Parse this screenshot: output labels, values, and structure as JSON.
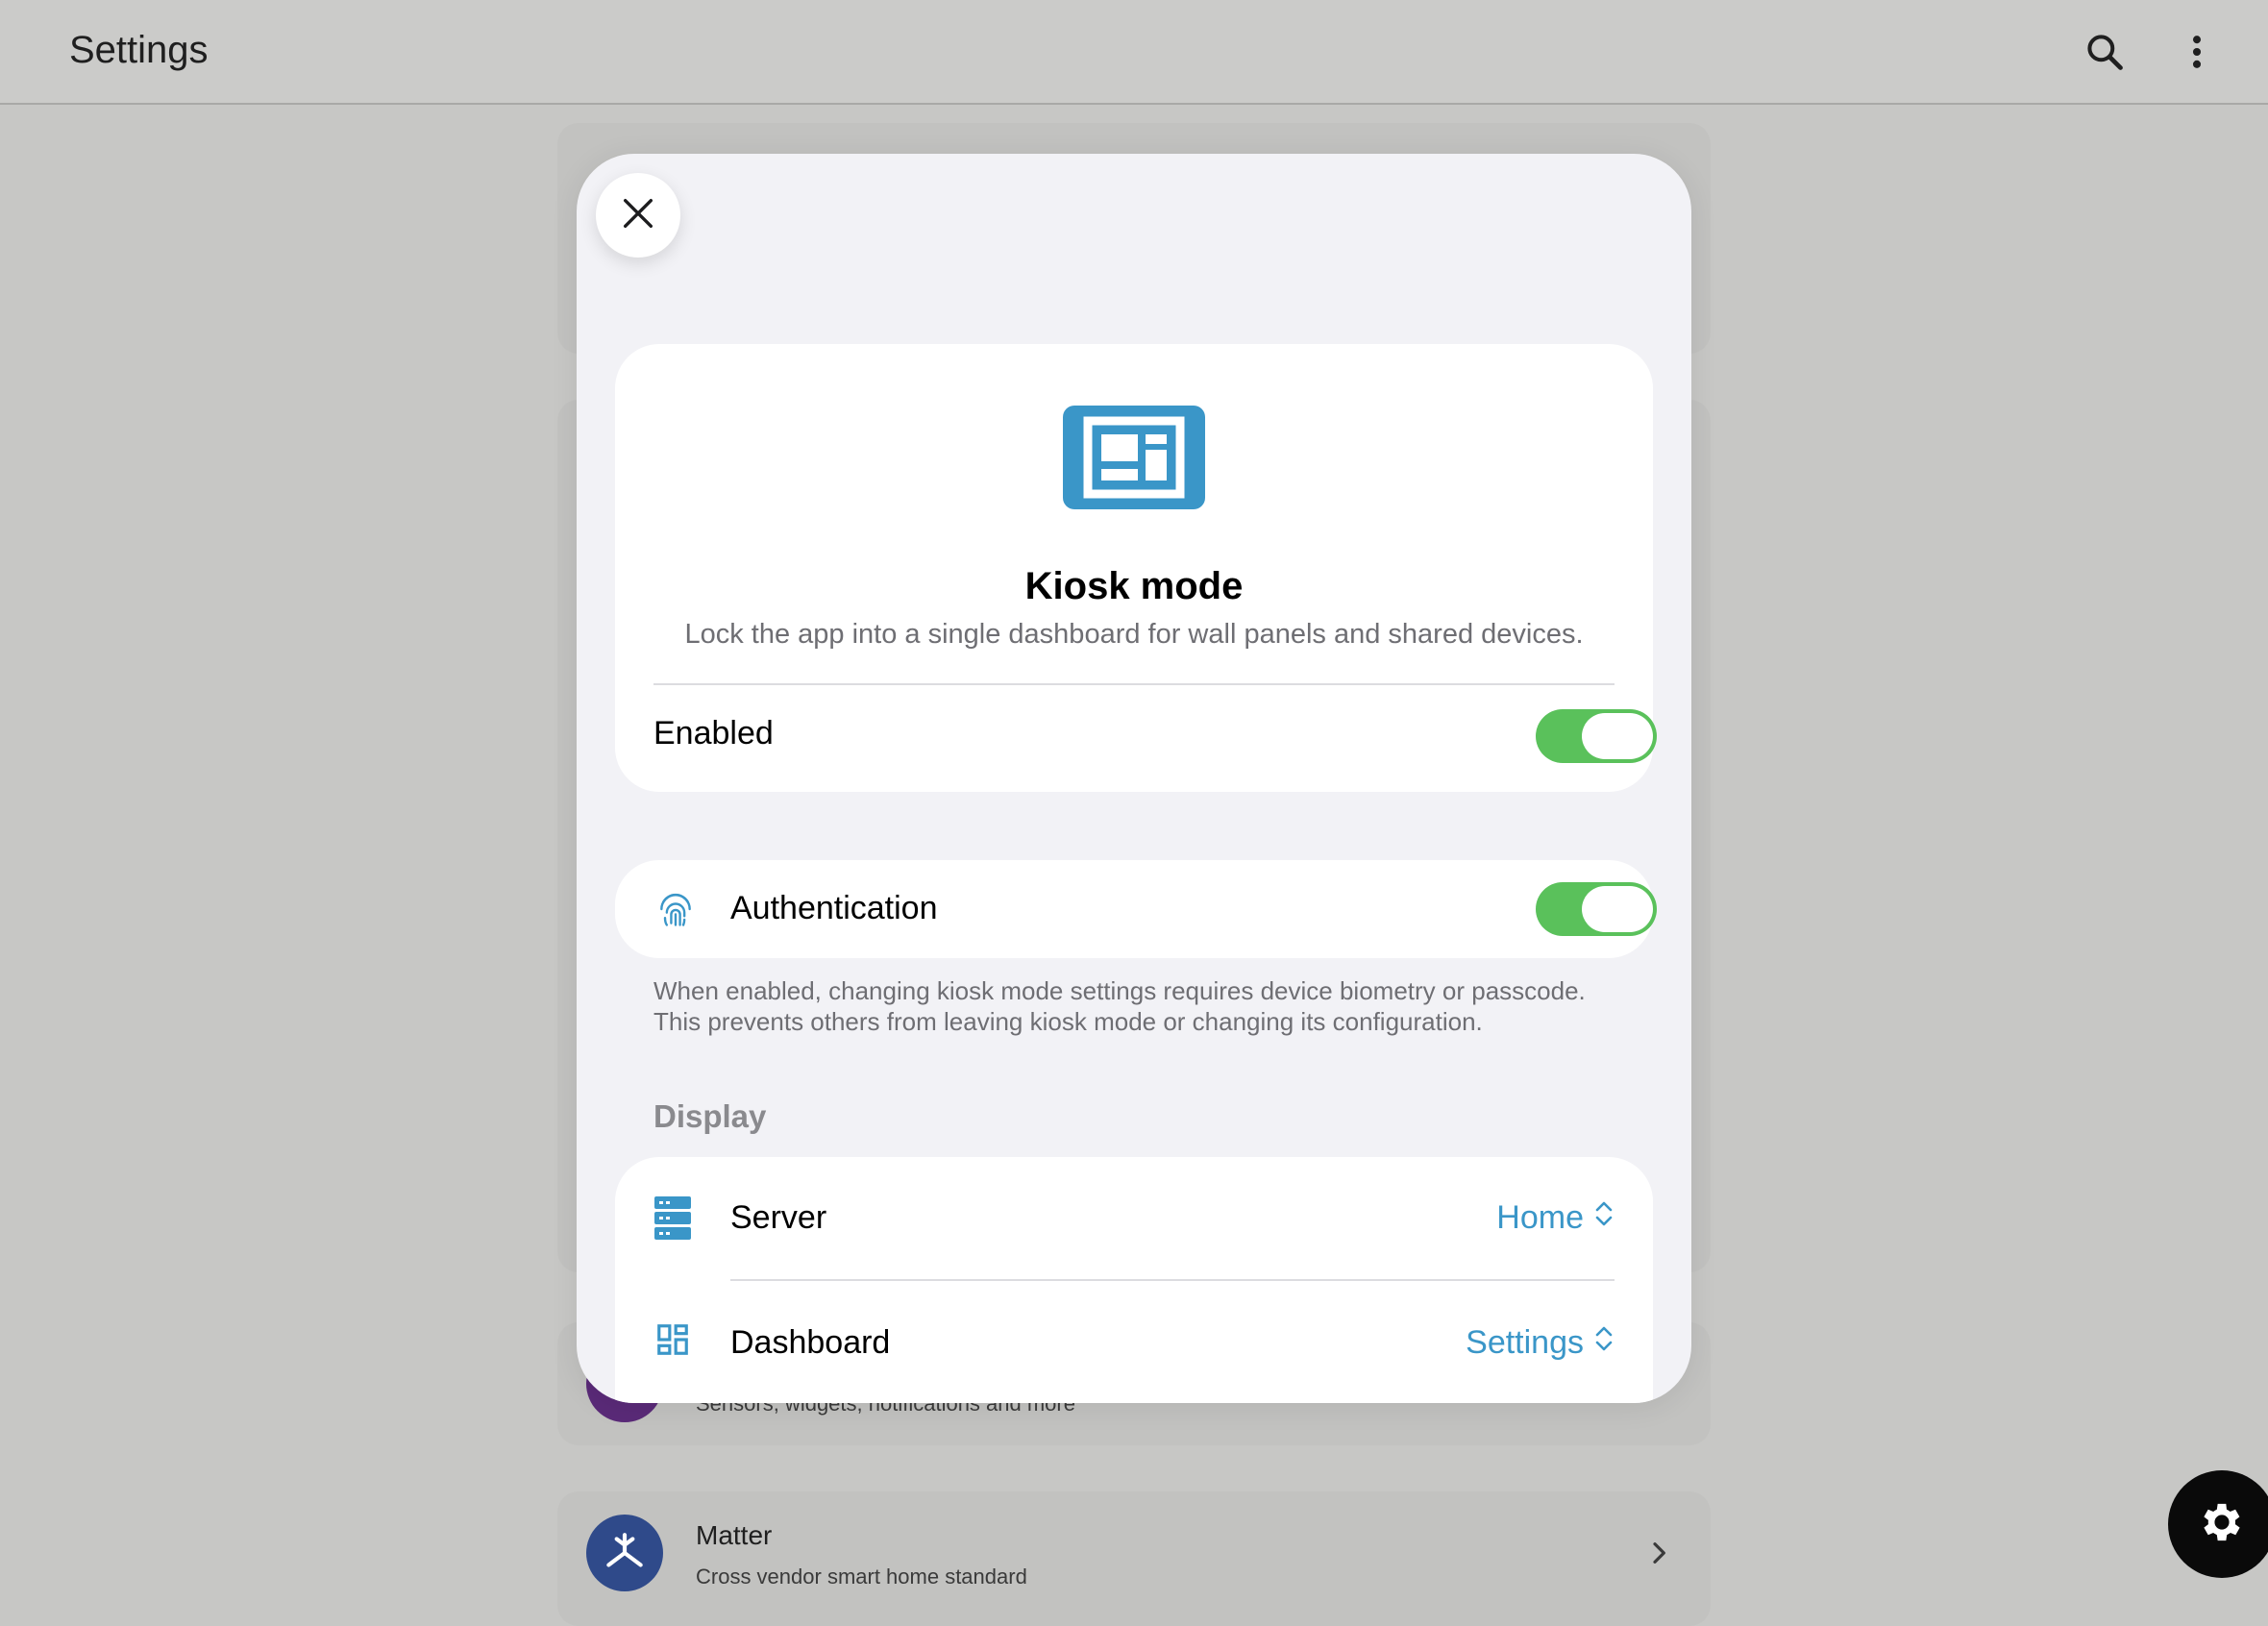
{
  "app_bar": {
    "title": "Settings",
    "search_icon": "search-icon",
    "more_icon": "more-vert-icon"
  },
  "background": {
    "companion_subtitle": "Sensors, widgets, notifications and more",
    "matter_title": "Matter",
    "matter_subtitle": "Cross vendor smart home standard"
  },
  "sheet": {
    "close_icon": "close-icon",
    "header": {
      "icon": "dashboard-panel-icon",
      "title": "Kiosk mode",
      "description": "Lock the app into a single dashboard for wall panels and shared devices."
    },
    "enabled_row": {
      "label": "Enabled",
      "value": true
    },
    "authentication_row": {
      "icon": "fingerprint-icon",
      "label": "Authentication",
      "value": true,
      "footnote": "When enabled, changing kiosk mode settings requires device biometry or passcode. This prevents others from leaving kiosk mode or changing its configuration."
    },
    "display_section": {
      "title": "Display",
      "rows": [
        {
          "icon": "server-icon",
          "label": "Server",
          "value": "Home"
        },
        {
          "icon": "dashboard-icon",
          "label": "Dashboard",
          "value": "Settings"
        }
      ]
    }
  },
  "colors": {
    "accent": "#3a96c8",
    "toggle_on": "#5ac15b",
    "sheet_bg": "#f2f2f6"
  }
}
